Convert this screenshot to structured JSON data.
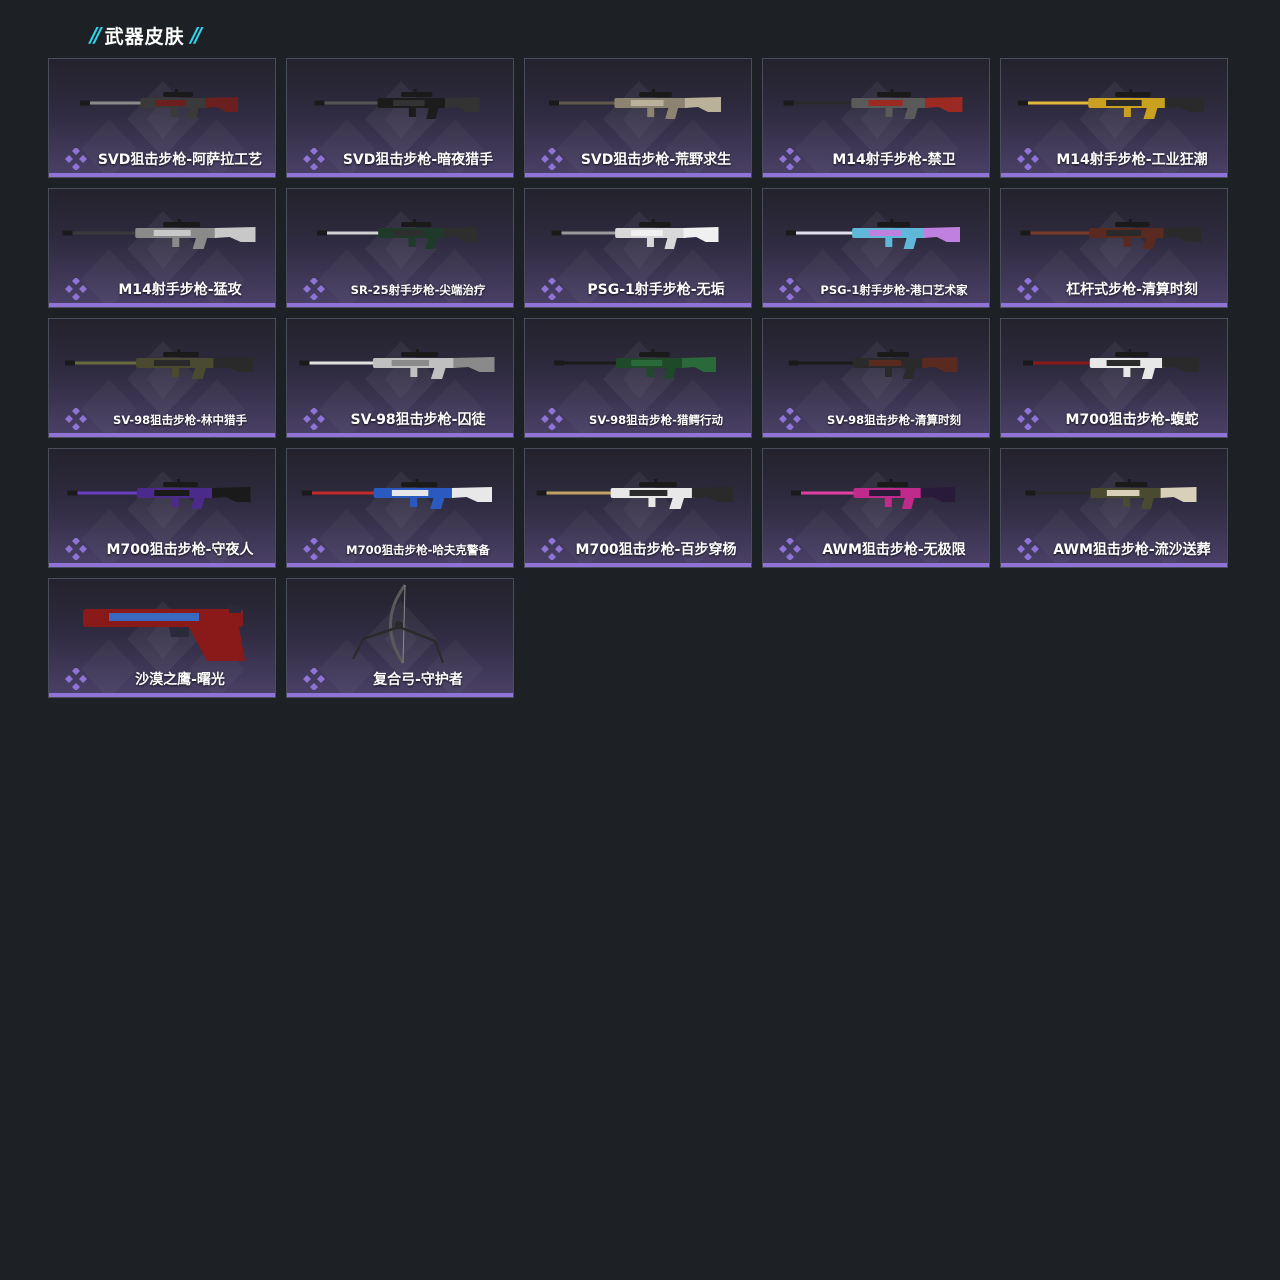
{
  "section": {
    "title": "武器皮肤"
  },
  "colors": {
    "background": "#1d2024",
    "accent_cyan": "#2fd6f0",
    "card_border": "#4a4d5c",
    "rarity_purple": "#8f73d6"
  },
  "skins": [
    {
      "name": "SVD狙击步枪-阿萨拉工艺",
      "palette": [
        "#3a3a3a",
        "#6b1f1f",
        "#8a8a8a"
      ],
      "icon": "sniper-rifle-icon"
    },
    {
      "name": "SVD狙击步枪-暗夜猎手",
      "palette": [
        "#1c1c1c",
        "#333333",
        "#555555"
      ],
      "icon": "sniper-rifle-icon"
    },
    {
      "name": "SVD狙击步枪-荒野求生",
      "palette": [
        "#8c8470",
        "#b9b19a",
        "#5e594b"
      ],
      "icon": "sniper-rifle-icon"
    },
    {
      "name": "M14射手步枪-禁卫",
      "palette": [
        "#5a5a5a",
        "#9a2a22",
        "#2a2a2a"
      ],
      "icon": "marksman-rifle-icon"
    },
    {
      "name": "M14射手步枪-工业狂潮",
      "palette": [
        "#c9a020",
        "#2a2a2a",
        "#e0b83a"
      ],
      "icon": "marksman-rifle-icon"
    },
    {
      "name": "M14射手步枪-猛攻",
      "palette": [
        "#8a8a8a",
        "#c8c8c8",
        "#3a3a3a"
      ],
      "icon": "marksman-rifle-icon"
    },
    {
      "name": "SR-25射手步枪-尖端治疗",
      "palette": [
        "#1f3a2a",
        "#2e2e2e",
        "#d0d0d0"
      ],
      "icon": "marksman-rifle-icon"
    },
    {
      "name": "PSG-1射手步枪-无垢",
      "palette": [
        "#d8d8d8",
        "#f0f0f0",
        "#9a9a9a"
      ],
      "icon": "marksman-rifle-icon"
    },
    {
      "name": "PSG-1射手步枪-港口艺术家",
      "palette": [
        "#5fb8d8",
        "#c080e0",
        "#e0e0f0"
      ],
      "icon": "marksman-rifle-icon"
    },
    {
      "name": "杠杆式步枪-清算时刻",
      "palette": [
        "#5a2a20",
        "#2a2a2a",
        "#7a3a28"
      ],
      "icon": "lever-rifle-icon"
    },
    {
      "name": "SV-98狙击步枪-林中猎手",
      "palette": [
        "#4a4a30",
        "#2a2a2a",
        "#6a6a40"
      ],
      "icon": "sniper-rifle-icon"
    },
    {
      "name": "SV-98狙击步枪-囚徒",
      "palette": [
        "#c0c0c0",
        "#8a8a8a",
        "#e0e0e0"
      ],
      "icon": "sniper-rifle-icon"
    },
    {
      "name": "SV-98狙击步枪-猎鳄行动",
      "palette": [
        "#1f4a2a",
        "#2a6a3a",
        "#1a1a1a"
      ],
      "icon": "sniper-rifle-icon"
    },
    {
      "name": "SV-98狙击步枪-清算时刻",
      "palette": [
        "#2a2a2a",
        "#5a2a20",
        "#1a1a1a"
      ],
      "icon": "sniper-rifle-icon"
    },
    {
      "name": "M700狙击步枪-蝮蛇",
      "palette": [
        "#e8e8e8",
        "#2a2a2a",
        "#8a1a1a"
      ],
      "icon": "sniper-rifle-icon"
    },
    {
      "name": "M700狙击步枪-守夜人",
      "palette": [
        "#4a2a8a",
        "#1a1a1a",
        "#6a40c0"
      ],
      "icon": "sniper-rifle-icon"
    },
    {
      "name": "M700狙击步枪-哈夫克警备",
      "palette": [
        "#2a5ac0",
        "#e8e8e8",
        "#c02a2a"
      ],
      "icon": "sniper-rifle-icon"
    },
    {
      "name": "M700狙击步枪-百步穿杨",
      "palette": [
        "#e8e8e8",
        "#2a2a2a",
        "#c0a060"
      ],
      "icon": "sniper-rifle-icon"
    },
    {
      "name": "AWM狙击步枪-无极限",
      "palette": [
        "#c02a8a",
        "#2a1a3a",
        "#e040a0"
      ],
      "icon": "sniper-rifle-icon"
    },
    {
      "name": "AWM狙击步枪-流沙送葬",
      "palette": [
        "#4a4a30",
        "#d8d0b8",
        "#2a2a2a"
      ],
      "icon": "sniper-rifle-icon"
    },
    {
      "name": "沙漠之鹰-曙光",
      "palette": [
        "#8a1a1a",
        "#2a2a3a",
        "#3a6ac0"
      ],
      "icon": "pistol-icon"
    },
    {
      "name": "复合弓-守护者",
      "palette": [
        "#2a2a2a",
        "#5a5a5a",
        "#1a1a1a"
      ],
      "icon": "bow-icon"
    }
  ]
}
